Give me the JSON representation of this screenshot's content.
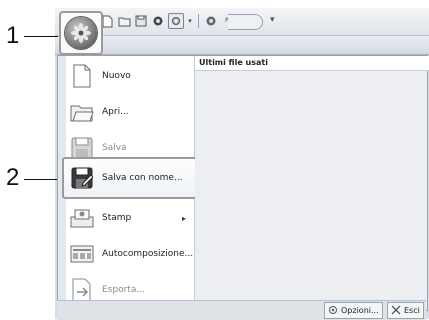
{
  "callouts": {
    "one": "1",
    "two": "2"
  },
  "qat": {
    "more_label": "▾"
  },
  "menu": {
    "items": [
      {
        "label": "Nuovo",
        "icon": "new-document-icon",
        "disabled": false
      },
      {
        "label": "Apri...",
        "icon": "open-folder-icon",
        "disabled": false
      },
      {
        "label": "Salva",
        "icon": "save-icon",
        "disabled": true
      },
      {
        "label": "Salva con nome...",
        "icon": "save-as-icon",
        "disabled": false,
        "highlighted": true
      },
      {
        "label": "Stamp",
        "icon": "stamp-icon",
        "disabled": false,
        "submenu": "▸"
      },
      {
        "label": "Autocomposizione...",
        "icon": "autocompose-icon",
        "disabled": false
      },
      {
        "label": "Esporta...",
        "icon": "export-icon",
        "disabled": true
      }
    ]
  },
  "recent": {
    "title": "Ultimi file usati"
  },
  "footer": {
    "options_label": "Opzioni...",
    "exit_label": "Esci"
  }
}
